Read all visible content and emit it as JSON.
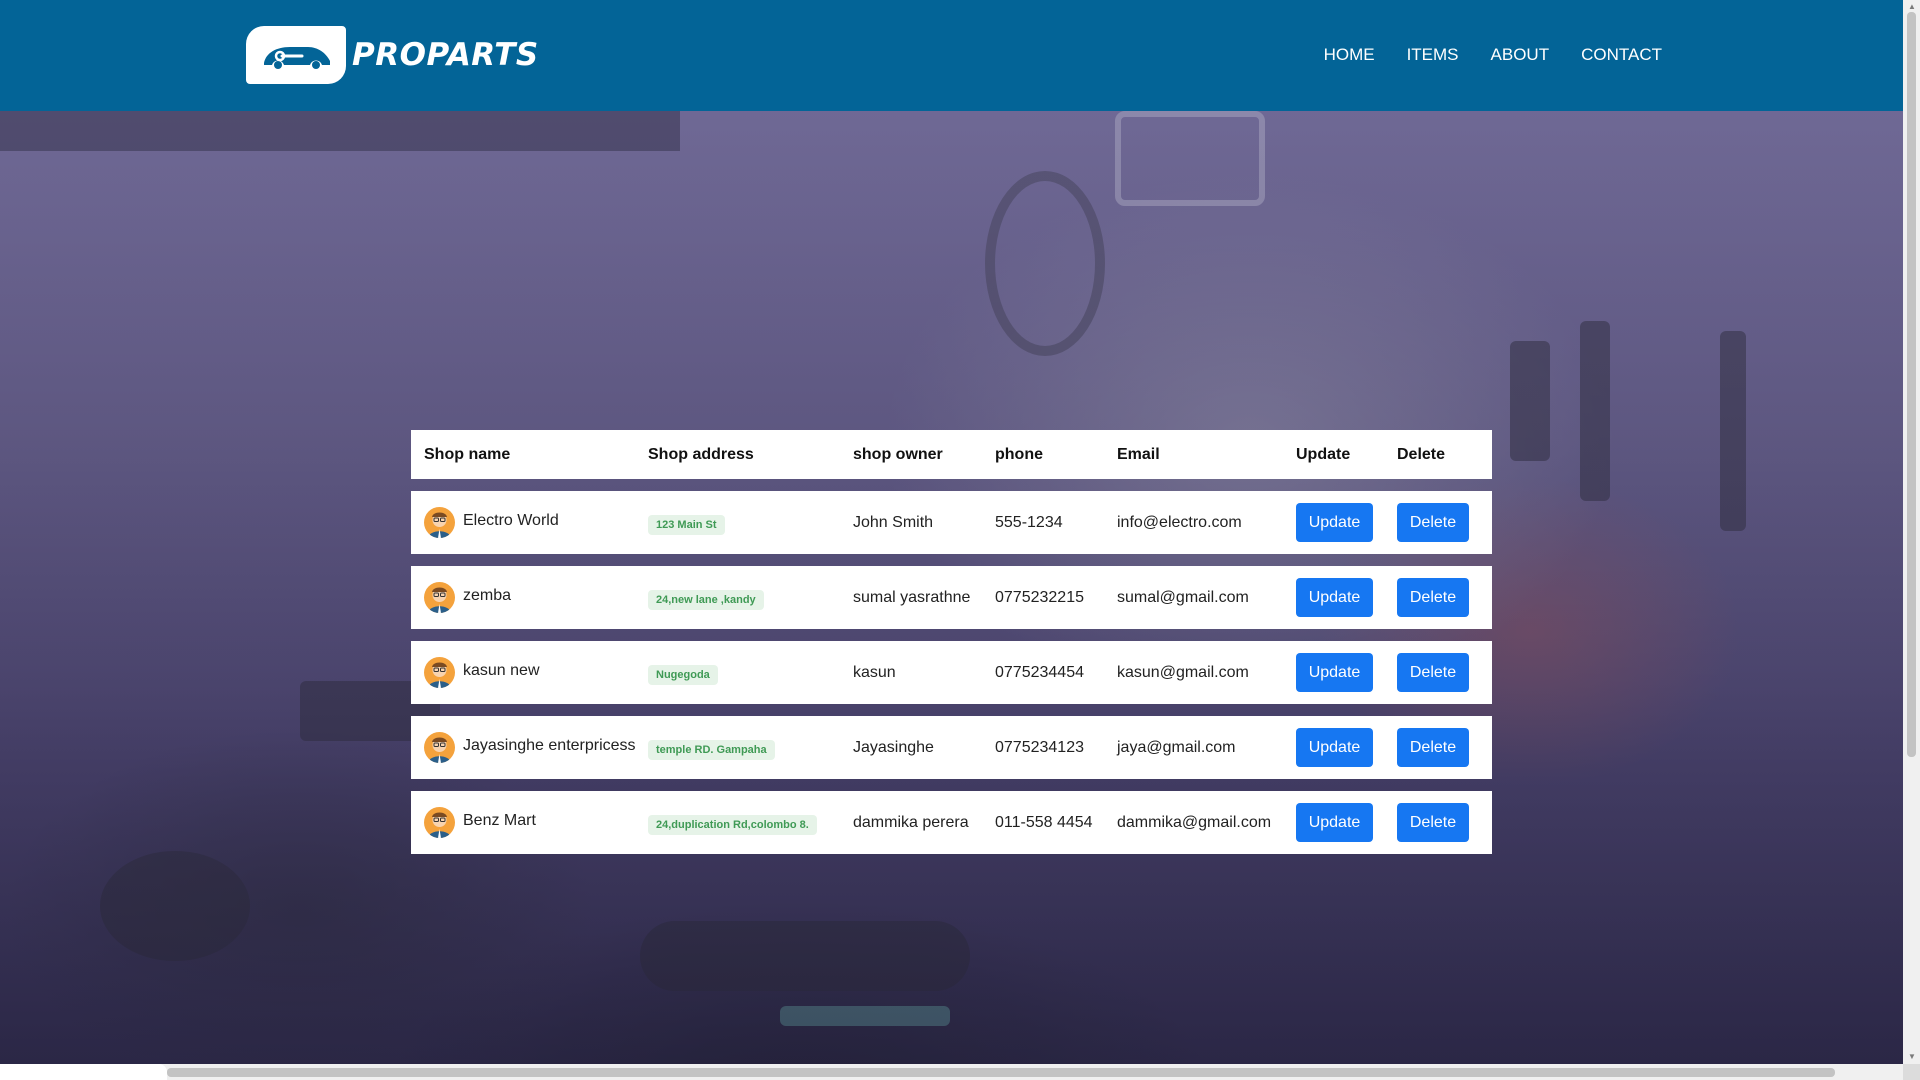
{
  "brand": {
    "name": "PROPARTS"
  },
  "nav": {
    "items": [
      "HOME",
      "ITEMS",
      "ABOUT",
      "CONTACT"
    ]
  },
  "table": {
    "headers": {
      "name": "Shop name",
      "address": "Shop address",
      "owner": "shop owner",
      "phone": "phone",
      "email": "Email",
      "update": "Update",
      "delete": "Delete"
    },
    "rows": [
      {
        "name": "Electro World",
        "address": "123 Main St",
        "owner": "John Smith",
        "phone": "555-1234",
        "email": "info@electro.com",
        "update": "Update",
        "delete": "Delete"
      },
      {
        "name": "zemba",
        "address": "24,new lane ,kandy",
        "owner": "sumal yasrathne",
        "phone": "0775232215",
        "email": "sumal@gmail.com",
        "update": "Update",
        "delete": "Delete"
      },
      {
        "name": "kasun new",
        "address": "Nugegoda",
        "owner": "kasun",
        "phone": "0775234454",
        "email": "kasun@gmail.com",
        "update": "Update",
        "delete": "Delete"
      },
      {
        "name": "Jayasinghe enterpricess",
        "address": "temple RD. Gampaha",
        "owner": "Jayasinghe",
        "phone": "0775234123",
        "email": "jaya@gmail.com",
        "update": "Update",
        "delete": "Delete"
      },
      {
        "name": "Benz Mart",
        "address": "24,duplication Rd,colombo 8.",
        "owner": "dammika perera",
        "phone": "011-558 4454",
        "email": "dammika@gmail.com",
        "update": "Update",
        "delete": "Delete"
      }
    ]
  },
  "colors": {
    "header": "#036497",
    "button": "#1677f2",
    "badge_bg": "#e6f3e8",
    "badge_text": "#3f9a55"
  },
  "icons": {
    "logo": "car-wrench-icon",
    "avatar": "user-avatar-icon"
  }
}
